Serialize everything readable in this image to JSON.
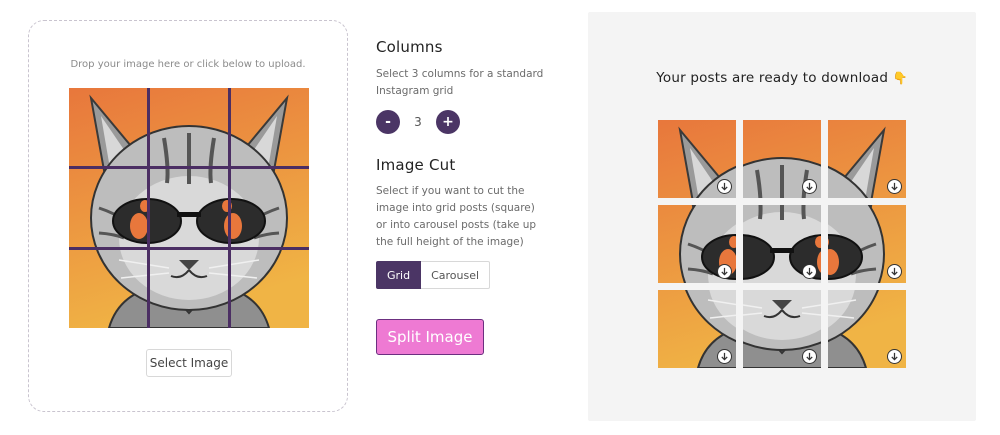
{
  "upload": {
    "hint": "Drop your image here or click below to upload.",
    "select_button": "Select Image"
  },
  "columns": {
    "title": "Columns",
    "description": "Select 3 columns for a standard Instagram grid",
    "minus": "-",
    "value": "3",
    "plus": "+"
  },
  "image_cut": {
    "title": "Image Cut",
    "description": "Select if you want to cut the image into grid posts (square) or into carousel posts (take up the full height of the image)",
    "options": [
      "Grid",
      "Carousel"
    ],
    "selected": "Grid"
  },
  "split_button": "Split Image",
  "result": {
    "title": "Your posts are ready to download",
    "emoji": "👇",
    "tile_count": 9
  },
  "colors": {
    "accent": "#4b3565",
    "split_button": "#ee7ad3",
    "bg_top": "#e8773c",
    "bg_bottom": "#f0b445"
  },
  "icons": [
    "download-icon",
    "minus-icon",
    "plus-icon",
    "pointing-down-emoji"
  ]
}
